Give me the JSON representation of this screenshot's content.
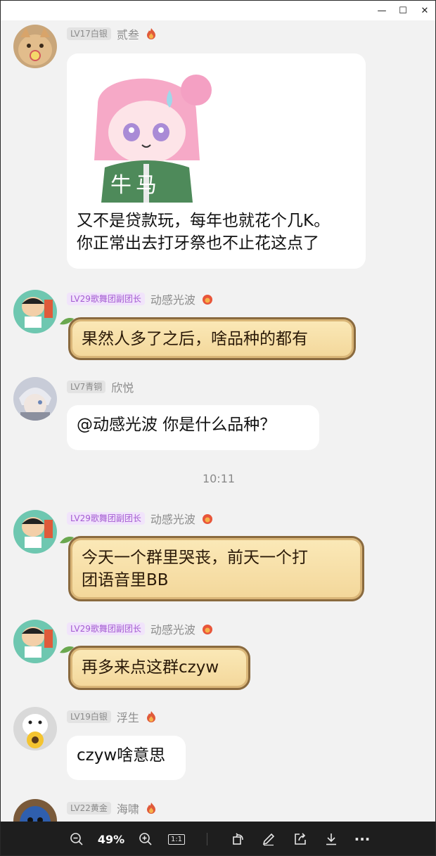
{
  "window": {
    "minimize": "—",
    "maximize": "☐",
    "close": "✕"
  },
  "messages": [
    {
      "level": "LV17白银",
      "nick": "贰叁",
      "sticker_text": "牛马",
      "text_lines": [
        "又不是贷款玩，每年也就花个几K。",
        "你正常出去打牙祭也不止花这点了"
      ]
    },
    {
      "level": "LV29歌舞团副团长",
      "nick": "动感光波",
      "text": "果然人多了之后，啥品种的都有"
    },
    {
      "level": "LV7青铜",
      "nick": "欣悦",
      "text": "@动感光波  你是什么品种？"
    },
    {
      "level": "LV29歌舞团副团长",
      "nick": "动感光波",
      "text_lines": [
        "今天一个群里哭丧，前天一个打",
        "团语音里BB"
      ]
    },
    {
      "level": "LV29歌舞团副团长",
      "nick": "动感光波",
      "text": "再多来点这群czyw"
    },
    {
      "level": "LV19白银",
      "nick": "浮生",
      "text": "czyw啥意思"
    },
    {
      "level": "LV22黄金",
      "nick": "海啸"
    }
  ],
  "timestamp": "10:11",
  "toolbar": {
    "zoom": "49%",
    "actual_size": "1:1",
    "more": "···"
  },
  "colors": {
    "bubble": "#ffffff",
    "fancy_fill": "#fbe9b8",
    "fancy_border": "#8a6a3e",
    "purple_badge": "#a45ad2",
    "background": "#f2f2f2"
  }
}
